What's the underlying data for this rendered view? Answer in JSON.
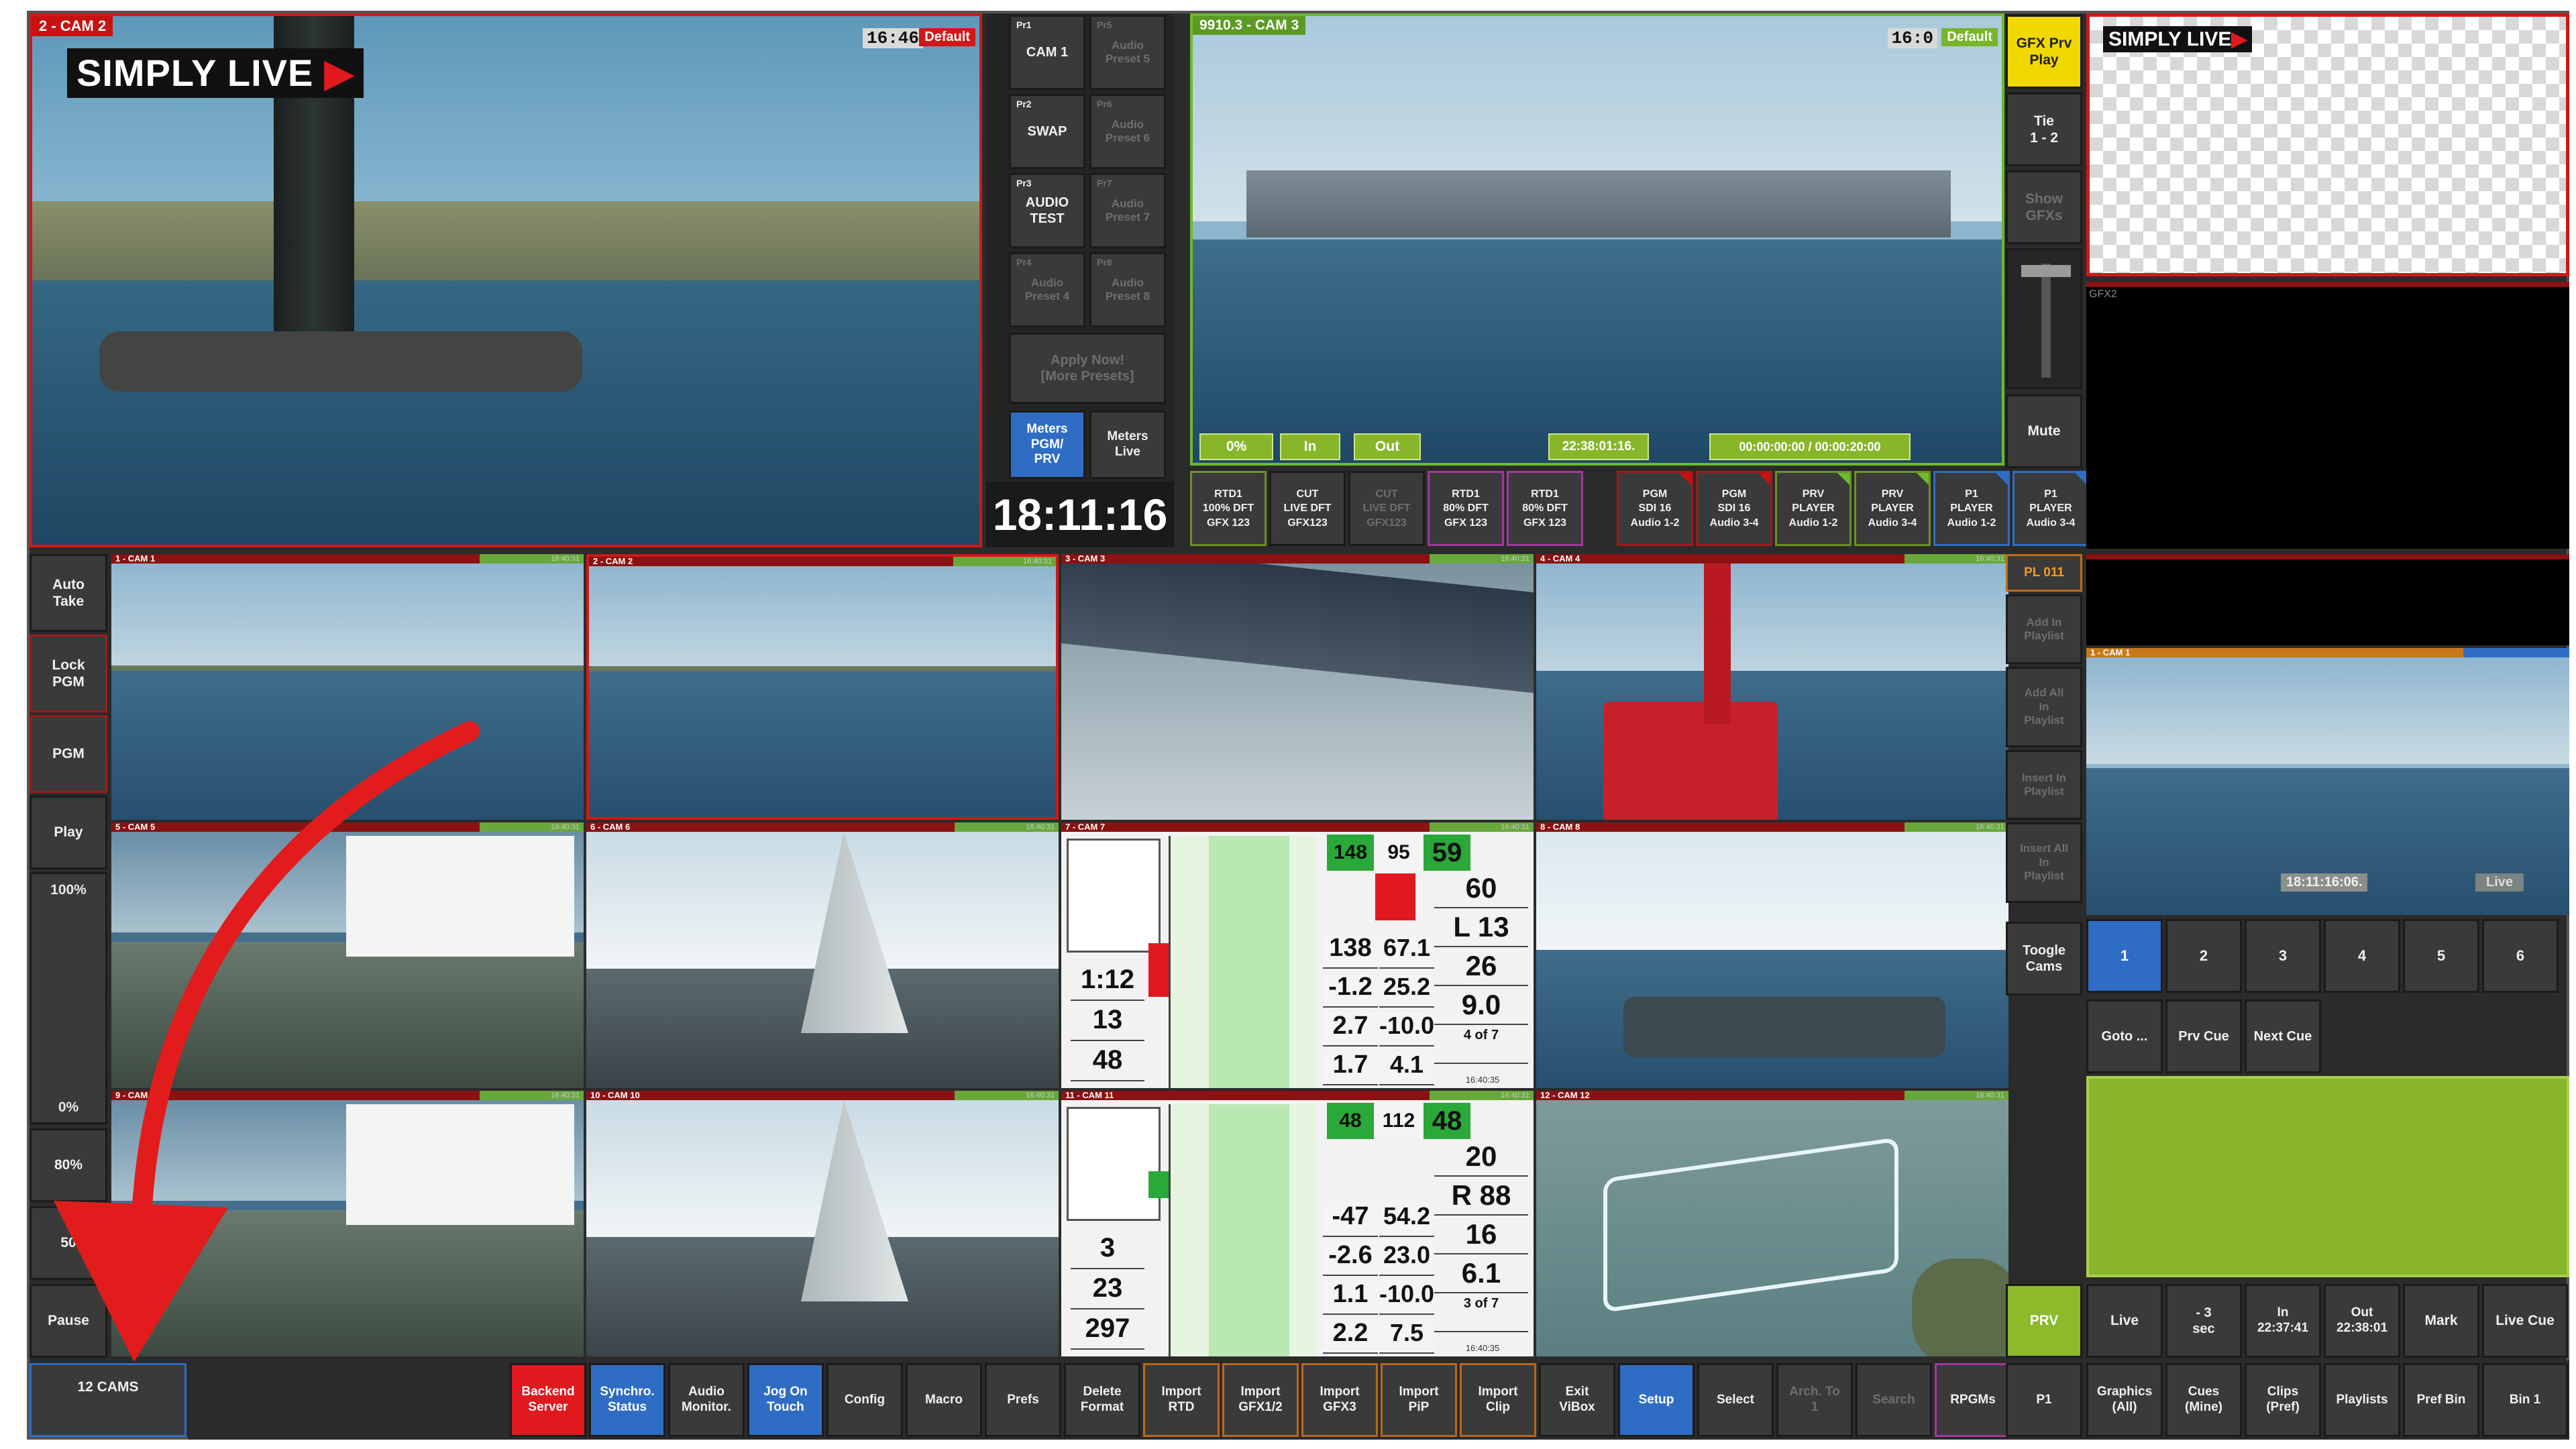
{
  "program_monitor": {
    "label": "2 - CAM 2",
    "timecode": "16:46",
    "badge": "Default",
    "logo_text": "SIMPLY LIVE"
  },
  "preview_monitor": {
    "label": "9910.3 - CAM 3",
    "timecode": "16:0",
    "badge": "Default",
    "fields": {
      "pct": "0%",
      "in": "In",
      "out": "Out",
      "time": "22:38:01:16.",
      "duration": "00:00:00:00 / 00:00:20:00"
    }
  },
  "presets": [
    {
      "tag": "Pr1",
      "label": "CAM 1",
      "active": true
    },
    {
      "tag": "Pr5",
      "label": "Audio\nPreset 5",
      "active": false
    },
    {
      "tag": "Pr2",
      "label": "SWAP",
      "active": true
    },
    {
      "tag": "Pr6",
      "label": "Audio\nPreset 6",
      "active": false
    },
    {
      "tag": "Pr3",
      "label": "AUDIO\nTEST",
      "active": true
    },
    {
      "tag": "Pr7",
      "label": "Audio\nPreset 7",
      "active": false
    },
    {
      "tag": "Pr4",
      "label": "Audio\nPreset 4",
      "active": false
    },
    {
      "tag": "Pr8",
      "label": "Audio\nPreset 8",
      "active": false
    }
  ],
  "apply_now": "Apply Now!\n[More Presets]",
  "meters": {
    "pgm": "Meters\nPGM/\nPRV",
    "live": "Meters\nLive"
  },
  "clock": "18:11:16",
  "gfx_column": {
    "gfx_prv_play": "GFX Prv\nPlay",
    "tie": "Tie\n1 - 2",
    "show_gfx": "Show\nGFXs",
    "mute": "Mute",
    "gfx2_label": "GFX2"
  },
  "audio_routing": [
    {
      "label": "RTD1\n100% DFT\nGFX 123"
    },
    {
      "label": "CUT\nLIVE DFT\nGFX123"
    },
    {
      "label": "CUT\nLIVE DFT\nGFX123"
    },
    {
      "label": "RTD1\n80% DFT\nGFX 123"
    },
    {
      "label": "RTD1\n80% DFT\nGFX 123"
    },
    {
      "label": "PGM\nSDI 16\nAudio 1-2"
    },
    {
      "label": "PGM\nSDI 16\nAudio 3-4"
    },
    {
      "label": "PRV\nPLAYER\nAudio 1-2"
    },
    {
      "label": "PRV\nPLAYER\nAudio 3-4"
    },
    {
      "label": "P1\nPLAYER\nAudio 1-2"
    },
    {
      "label": "P1\nPLAYER\nAudio 3-4"
    }
  ],
  "left_controls": {
    "auto_take": "Auto\nTake",
    "lock_pgm": "Lock\nPGM",
    "pgm": "PGM",
    "play": "Play",
    "speed_top": "100%",
    "speed_bottom": "0%",
    "speed_80": "80%",
    "speed_50": "50",
    "pause": "Pause",
    "cams": "12 CAMS"
  },
  "cameras": [
    {
      "label": "1 - CAM 1"
    },
    {
      "label": "2 - CAM 2"
    },
    {
      "label": "3 - CAM 3"
    },
    {
      "label": "4 - CAM 4"
    },
    {
      "label": "5 - CAM 5"
    },
    {
      "label": "6 - CAM 6"
    },
    {
      "label": "7 - CAM 7"
    },
    {
      "label": "8 - CAM 8"
    },
    {
      "label": "9 - CAM"
    },
    {
      "label": "10 - CAM 10"
    },
    {
      "label": "11 - CAM 11"
    },
    {
      "label": "12 - CAM 12"
    }
  ],
  "tile_timecode": "16:40:31",
  "telemetry": {
    "cam7": {
      "top": [
        "148",
        "95",
        "59"
      ],
      "vals": [
        "60",
        "L 13",
        "26",
        "9.0",
        "4 of 7"
      ],
      "left": [
        "1:12",
        "13",
        "48"
      ],
      "pairs": [
        [
          "138",
          "67.1"
        ],
        [
          "-1.2",
          "25.2"
        ],
        [
          "2.7",
          "-10.0"
        ],
        [
          "1.7",
          "4.1"
        ]
      ],
      "clock": "16:40:35"
    },
    "cam11": {
      "top": [
        "48",
        "112",
        "48"
      ],
      "vals": [
        "20",
        "R 88",
        "16",
        "6.1",
        "3 of 7"
      ],
      "left": [
        "3",
        "23",
        "297"
      ],
      "pairs": [
        [
          "-47",
          "54.2"
        ],
        [
          "-2.6",
          "23.0"
        ],
        [
          "1.1",
          "-10.0"
        ],
        [
          "2.2",
          "7.5"
        ]
      ],
      "clock": "16:40:35"
    }
  },
  "playlist": {
    "pl_label": "PL 011",
    "add_in": "Add In\nPlaylist",
    "add_all_in": "Add All\nIn\nPlaylist",
    "insert_in": "Insert In\nPlaylist",
    "insert_all_in": "Insert All\nIn\nPlaylist",
    "toogle_cams": "Toogle\nCams",
    "prv": "PRV"
  },
  "right_player": {
    "cam_label": "1 - CAM 1",
    "timecode": "18:11:16:06.",
    "status": "Live"
  },
  "cam_selector": [
    "1",
    "2",
    "3",
    "4",
    "5",
    "6"
  ],
  "cue_nav": {
    "goto": "Goto ...",
    "prv_cue": "Prv Cue",
    "next_cue": "Next Cue"
  },
  "cue_row": {
    "live": "Live",
    "minus3": "- 3\nsec",
    "in": "In\n22:37:41",
    "out": "Out\n22:38:01",
    "mark": "Mark",
    "live_cue": "Live Cue"
  },
  "bottom_bar": {
    "backend": "Backend\nServer",
    "synchro": "Synchro.\nStatus",
    "audio_monitor": "Audio\nMonitor.",
    "jog": "Jog On\nTouch",
    "config": "Config",
    "macro": "Macro",
    "prefs": "Prefs",
    "delete_format": "Delete\nFormat",
    "import_rtd": "Import\nRTD",
    "import_gfx12": "Import\nGFX1/2",
    "import_gfx3": "Import\nGFX3",
    "import_pip": "Import\nPiP",
    "import_clip": "Import\nClip",
    "exit_vibox": "Exit\nViBox",
    "setup": "Setup",
    "select": "Select",
    "arch_to": "Arch. To\n1",
    "search": "Search",
    "rpgms": "RPGMs",
    "p1": "P1",
    "graphics": "Graphics\n(All)",
    "cues": "Cues\n(Mine)",
    "clips": "Clips\n(Pref)",
    "playlists": "Playlists",
    "pref_bin": "Pref Bin",
    "bin1": "Bin 1"
  },
  "colors": {
    "accent_red": "#e0191f",
    "accent_blue": "#2f6dc4",
    "accent_yellow": "#f0d800",
    "accent_green": "#8cba2a"
  }
}
